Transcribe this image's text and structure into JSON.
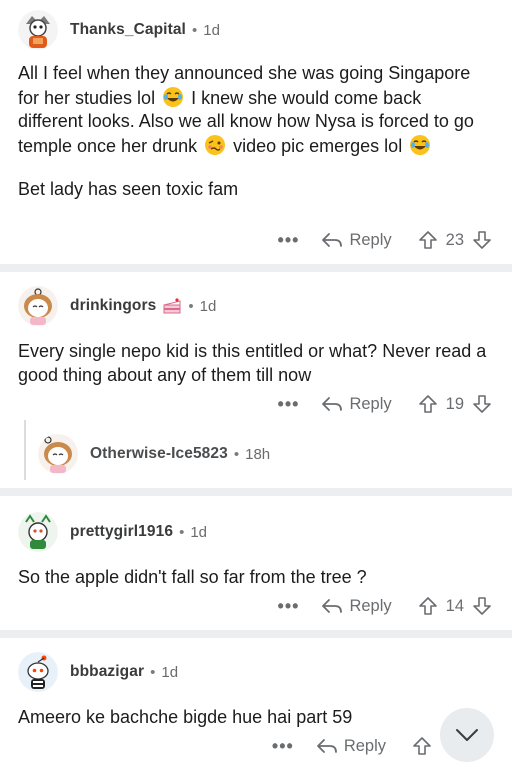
{
  "comments": [
    {
      "username": "Thanks_Capital",
      "age": "1d",
      "paragraphs": [
        [
          "All I feel when they announced she was going Singapore for her studies lol ",
          "😂",
          " I knew she would come back different looks. Also we all know how Nysa is forced to go temple once her drunk ",
          "🥴",
          " video pic emerges lol ",
          "😂"
        ],
        [
          "Bet lady has seen toxic fam"
        ]
      ],
      "reply_label": "Reply",
      "votes": "23"
    },
    {
      "username": "drinkingors",
      "flair_icon": "cake-icon",
      "age": "1d",
      "text": "Every single nepo kid is this entitled or what? Never read a good thing about any of them till now",
      "reply_label": "Reply",
      "votes": "19",
      "replies": [
        {
          "username": "Otherwise-Ice5823",
          "age": "18h"
        }
      ]
    },
    {
      "username": "prettygirl1916",
      "age": "1d",
      "text": "So the apple didn't fall so far from the tree ?",
      "reply_label": "Reply",
      "votes": "14"
    },
    {
      "username": "bbbazigar",
      "age": "1d",
      "text": "Ameero ke bachche bigde hue hai part 59",
      "reply_label": "Reply",
      "votes": ""
    }
  ],
  "more_label": "•••",
  "separator_dot": "•",
  "colors": {
    "separator": "#eceef0",
    "meta_gray": "#6b6b6b",
    "text": "#1c1c1c",
    "fab_bg": "#e9ecef"
  }
}
